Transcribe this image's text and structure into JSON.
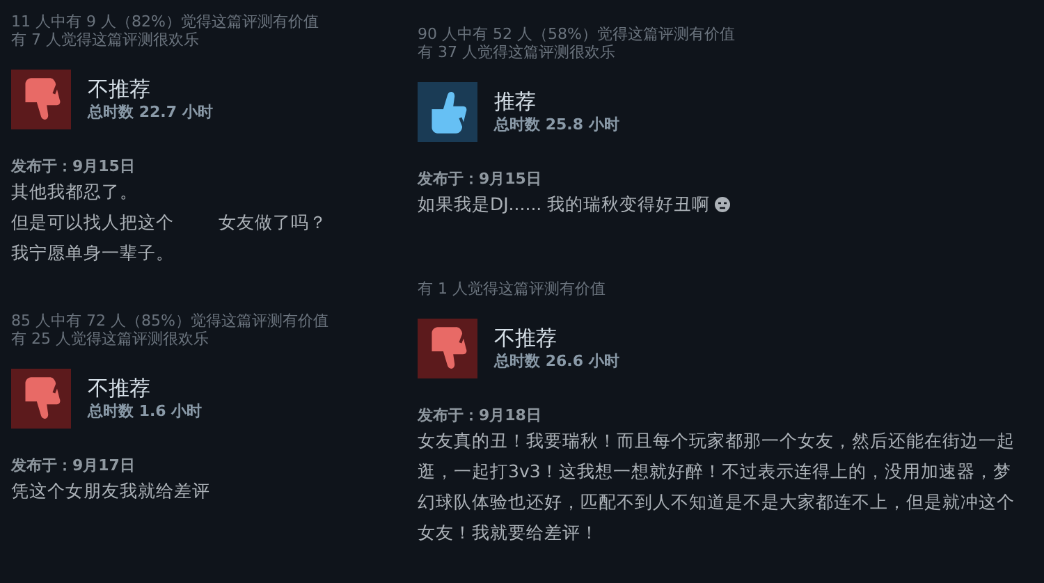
{
  "columns": [
    {
      "reviews": [
        {
          "helpful": [
            "11 人中有 9 人（82%）觉得这篇评测有价值",
            "有 7 人觉得这篇评测很欢乐"
          ],
          "kind": "thumbs_down",
          "verdict": "不推荐",
          "hours": "总时数 22.7 小时",
          "posted": "发布于：9月15日",
          "body": [
            "其他我都忍了。",
            "但是可以找人把这个        女友做了吗？",
            "我宁愿单身一辈子。"
          ]
        },
        {
          "helpful": [
            "85 人中有 72 人（85%）觉得这篇评测有价值",
            "有 25 人觉得这篇评测很欢乐"
          ],
          "kind": "thumbs_down",
          "verdict": "不推荐",
          "hours": "总时数 1.6 小时",
          "posted": "发布于：9月17日",
          "body": [
            "凭这个女朋友我就给差评"
          ]
        }
      ]
    },
    {
      "reviews": [
        {
          "helpful": [
            "90 人中有 52 人（58%）觉得这篇评测有价值",
            "有 37 人觉得这篇评测很欢乐"
          ],
          "kind": "thumbs_up",
          "verdict": "推荐",
          "hours": "总时数 25.8 小时",
          "posted": "发布于：9月15日",
          "body": [
            "如果我是DJ...... 我的瑞秋变得好丑啊"
          ],
          "emoji": true
        },
        {
          "helpful": [
            "有 1 人觉得这篇评测有价值"
          ],
          "kind": "thumbs_down",
          "verdict": "不推荐",
          "hours": "总时数 26.6 小时",
          "posted": "发布于：9月18日",
          "body": [
            "女友真的丑！我要瑞秋！而且每个玩家都那一个女友，然后还能在街边一起逛，一起打3v3！这我想一想就好醉！不过表示连得上的，没用加速器，梦幻球队体验也还好，匹配不到人不知道是不是大家都连不上，但是就冲这个女友！我就要给差评！"
          ]
        }
      ]
    }
  ]
}
